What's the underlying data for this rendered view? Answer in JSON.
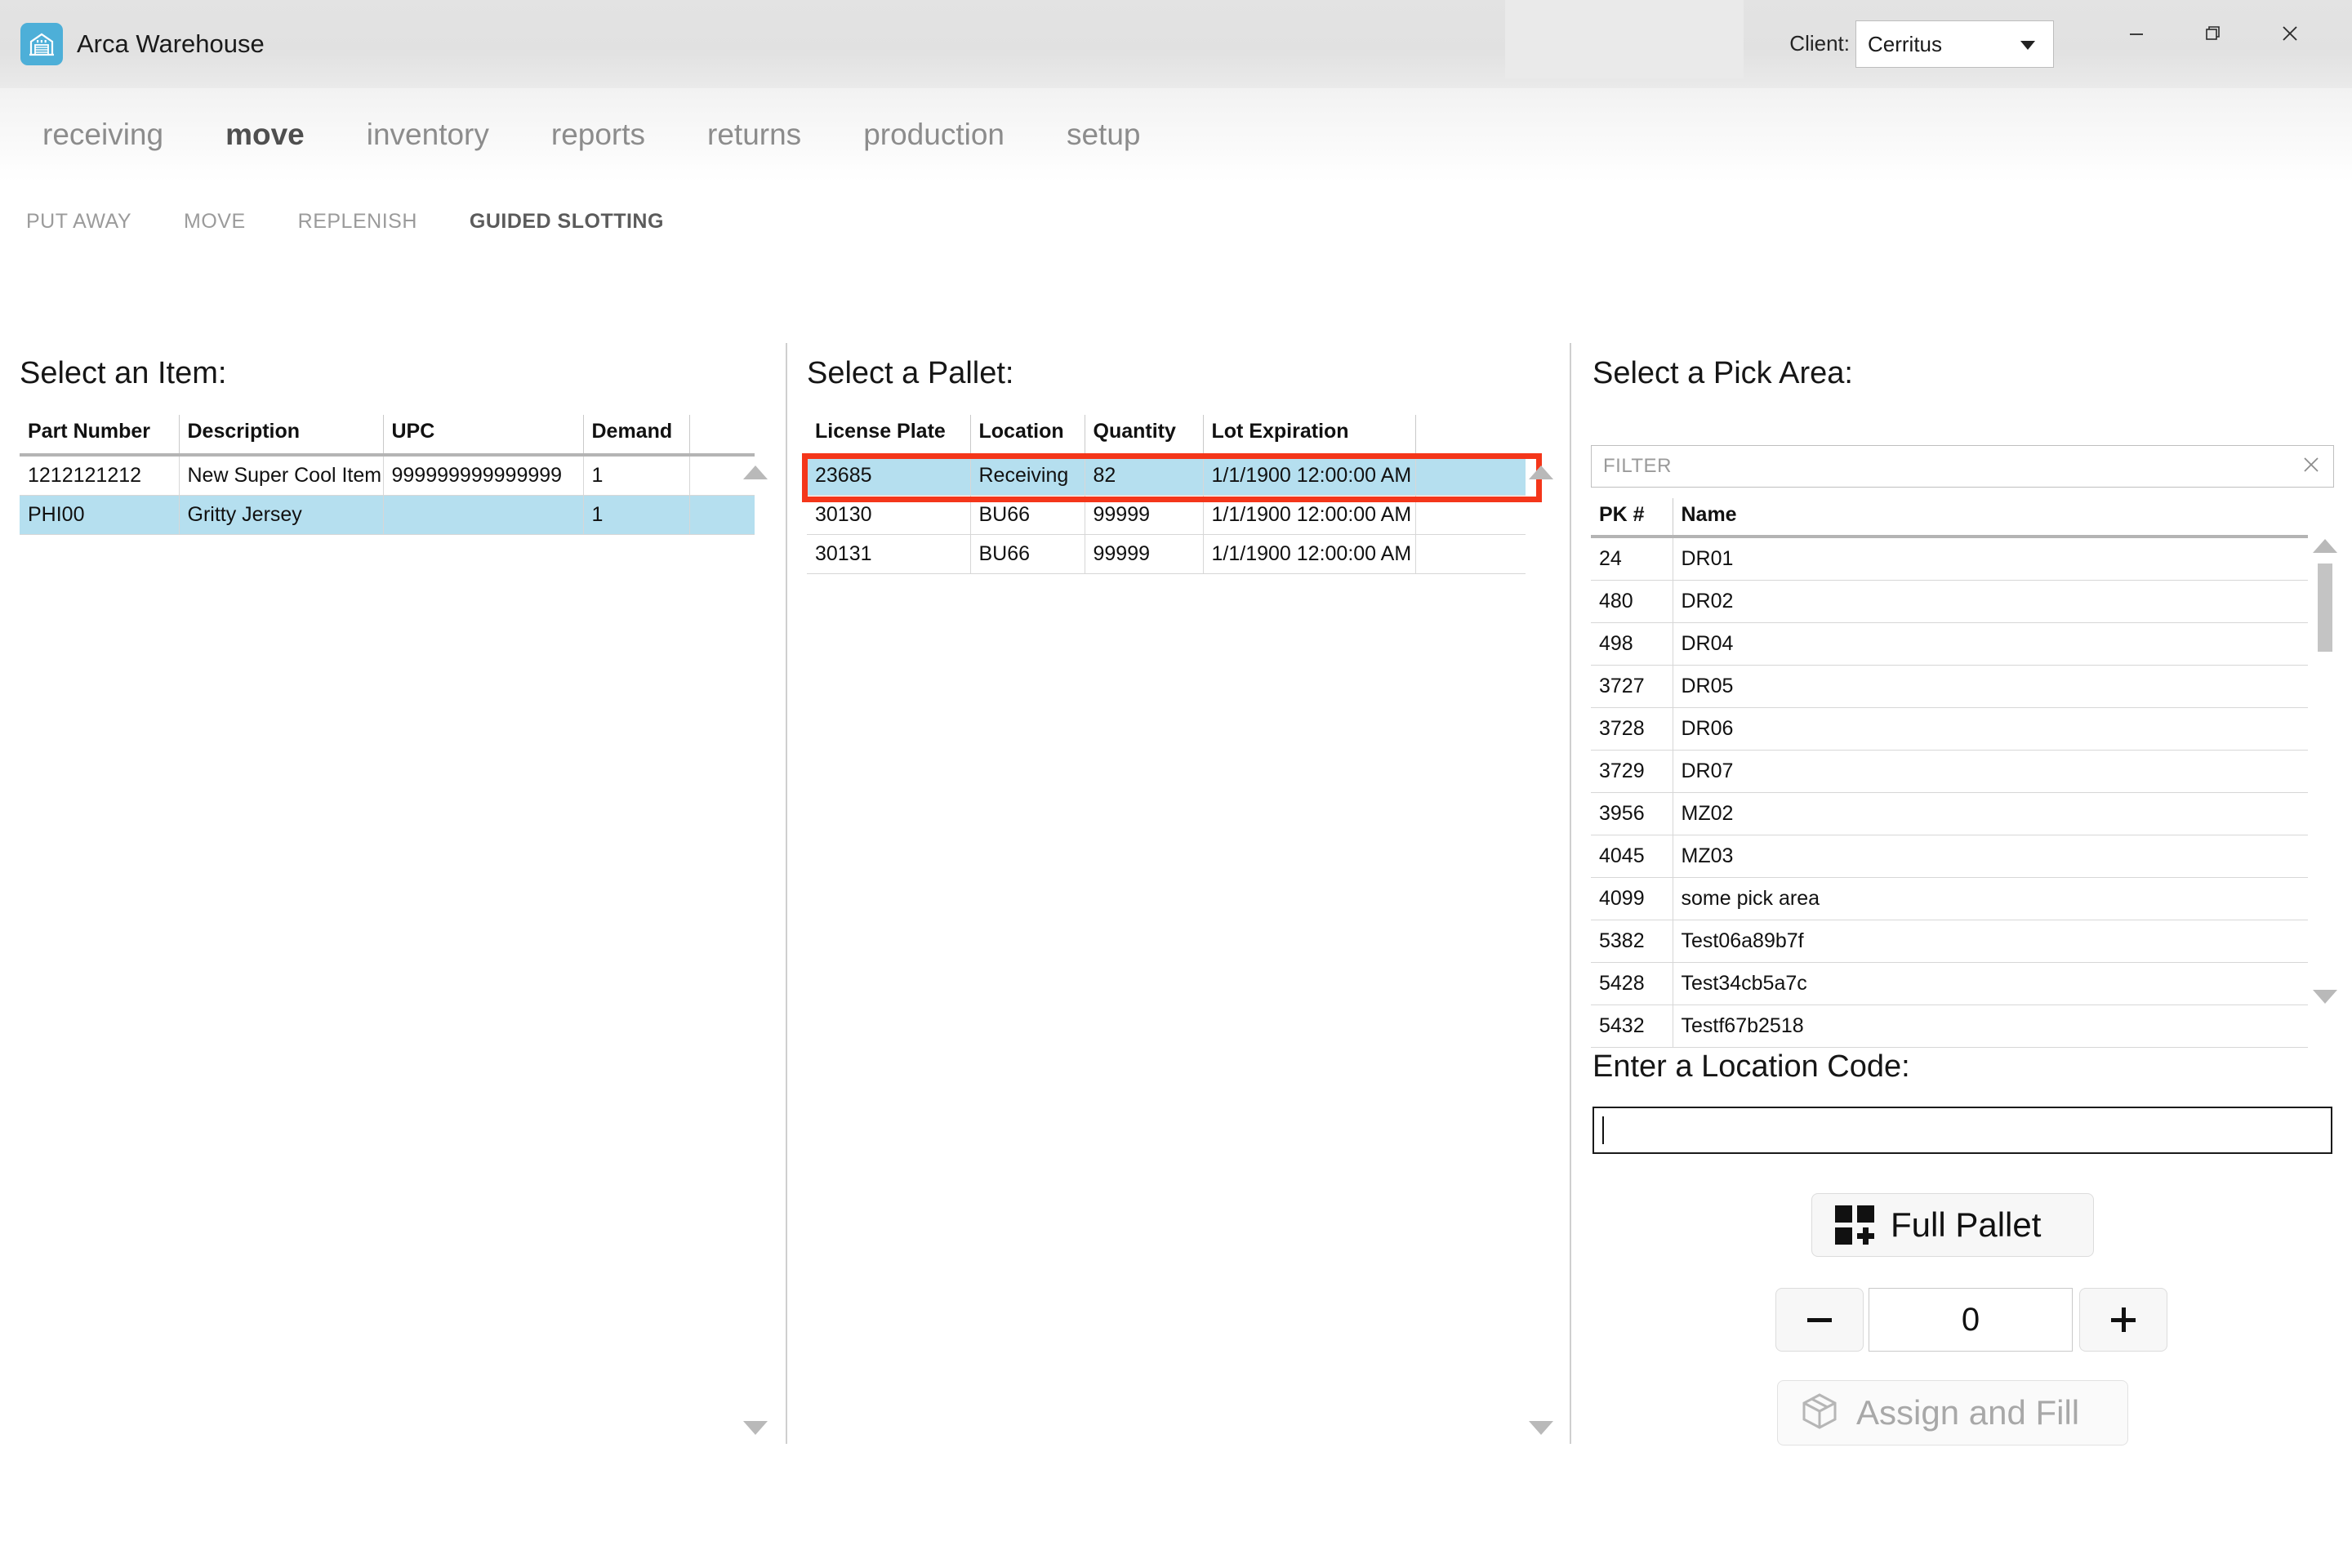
{
  "window": {
    "app_title": "Arca Warehouse",
    "app_icon": "warehouse-icon",
    "client_label": "Client:",
    "client_value": "Cerritus",
    "minimize_icon": "minimize-icon",
    "maximize_icon": "restore-icon",
    "close_icon": "close-icon",
    "accent_color": "#4dafd8",
    "highlight_color": "#f4361a",
    "selection_color": "#b5dfef"
  },
  "main_nav": {
    "items": [
      {
        "label": "receiving",
        "active": false
      },
      {
        "label": "move",
        "active": true
      },
      {
        "label": "inventory",
        "active": false
      },
      {
        "label": "reports",
        "active": false
      },
      {
        "label": "returns",
        "active": false
      },
      {
        "label": "production",
        "active": false
      },
      {
        "label": "setup",
        "active": false
      }
    ]
  },
  "sub_nav": {
    "items": [
      {
        "label": "PUT AWAY",
        "active": false
      },
      {
        "label": "MOVE",
        "active": false
      },
      {
        "label": "REPLENISH",
        "active": false
      },
      {
        "label": "GUIDED SLOTTING",
        "active": true
      }
    ]
  },
  "item_panel": {
    "title": "Select an Item:",
    "columns": [
      "Part Number",
      "Description",
      "UPC",
      "Demand",
      ""
    ],
    "rows": [
      {
        "part_number": "1212121212",
        "description": "New Super Cool Item",
        "upc": "999999999999999",
        "demand": "1",
        "blank": "",
        "selected": false
      },
      {
        "part_number": "PHI00",
        "description": "Gritty Jersey",
        "upc": "",
        "demand": "1",
        "blank": "",
        "selected": true
      }
    ],
    "scroll_up_icon": "scroll-up-arrow",
    "scroll_down_icon": "scroll-down-arrow"
  },
  "pallet_panel": {
    "title": "Select a Pallet:",
    "columns": [
      "License Plate",
      "Location",
      "Quantity",
      "Lot Expiration",
      ""
    ],
    "rows": [
      {
        "license_plate": "23685",
        "location": "Receiving",
        "quantity": "82",
        "lot_expiration": "1/1/1900 12:00:00 AM",
        "blank": "",
        "selected": true,
        "highlighted": true
      },
      {
        "license_plate": "30130",
        "location": "BU66",
        "quantity": "99999",
        "lot_expiration": "1/1/1900 12:00:00 AM",
        "blank": "",
        "selected": false,
        "highlighted": false
      },
      {
        "license_plate": "30131",
        "location": "BU66",
        "quantity": "99999",
        "lot_expiration": "1/1/1900 12:00:00 AM",
        "blank": "",
        "selected": false,
        "highlighted": false
      }
    ],
    "scroll_up_icon": "scroll-up-arrow",
    "scroll_down_icon": "scroll-down-arrow"
  },
  "pick_area_panel": {
    "title": "Select a Pick Area:",
    "filter_placeholder": "FILTER",
    "filter_value": "",
    "clear_icon": "clear-x-icon",
    "columns": [
      "PK #",
      "Name"
    ],
    "rows": [
      {
        "pk": "24",
        "name": "DR01"
      },
      {
        "pk": "480",
        "name": "DR02"
      },
      {
        "pk": "498",
        "name": "DR04"
      },
      {
        "pk": "3727",
        "name": "DR05"
      },
      {
        "pk": "3728",
        "name": "DR06"
      },
      {
        "pk": "3729",
        "name": "DR07"
      },
      {
        "pk": "3956",
        "name": "MZ02"
      },
      {
        "pk": "4045",
        "name": "MZ03"
      },
      {
        "pk": "4099",
        "name": "some pick area"
      },
      {
        "pk": "5382",
        "name": "Test06a89b7f"
      },
      {
        "pk": "5428",
        "name": "Test34cb5a7c"
      },
      {
        "pk": "5432",
        "name": "Testf67b2518"
      }
    ],
    "scroll_up_icon": "scroll-up-arrow",
    "scroll_down_icon": "scroll-down-arrow"
  },
  "location_code": {
    "title": "Enter a Location Code:",
    "value": "",
    "focused": true
  },
  "actions": {
    "full_pallet_label": "Full Pallet",
    "full_pallet_icon": "full-pallet-grid-icon",
    "decrement_label": "—",
    "increment_label": "+",
    "quantity_value": "0",
    "assign_label": "Assign and Fill",
    "assign_icon": "box-3d-icon",
    "assign_disabled": true
  }
}
